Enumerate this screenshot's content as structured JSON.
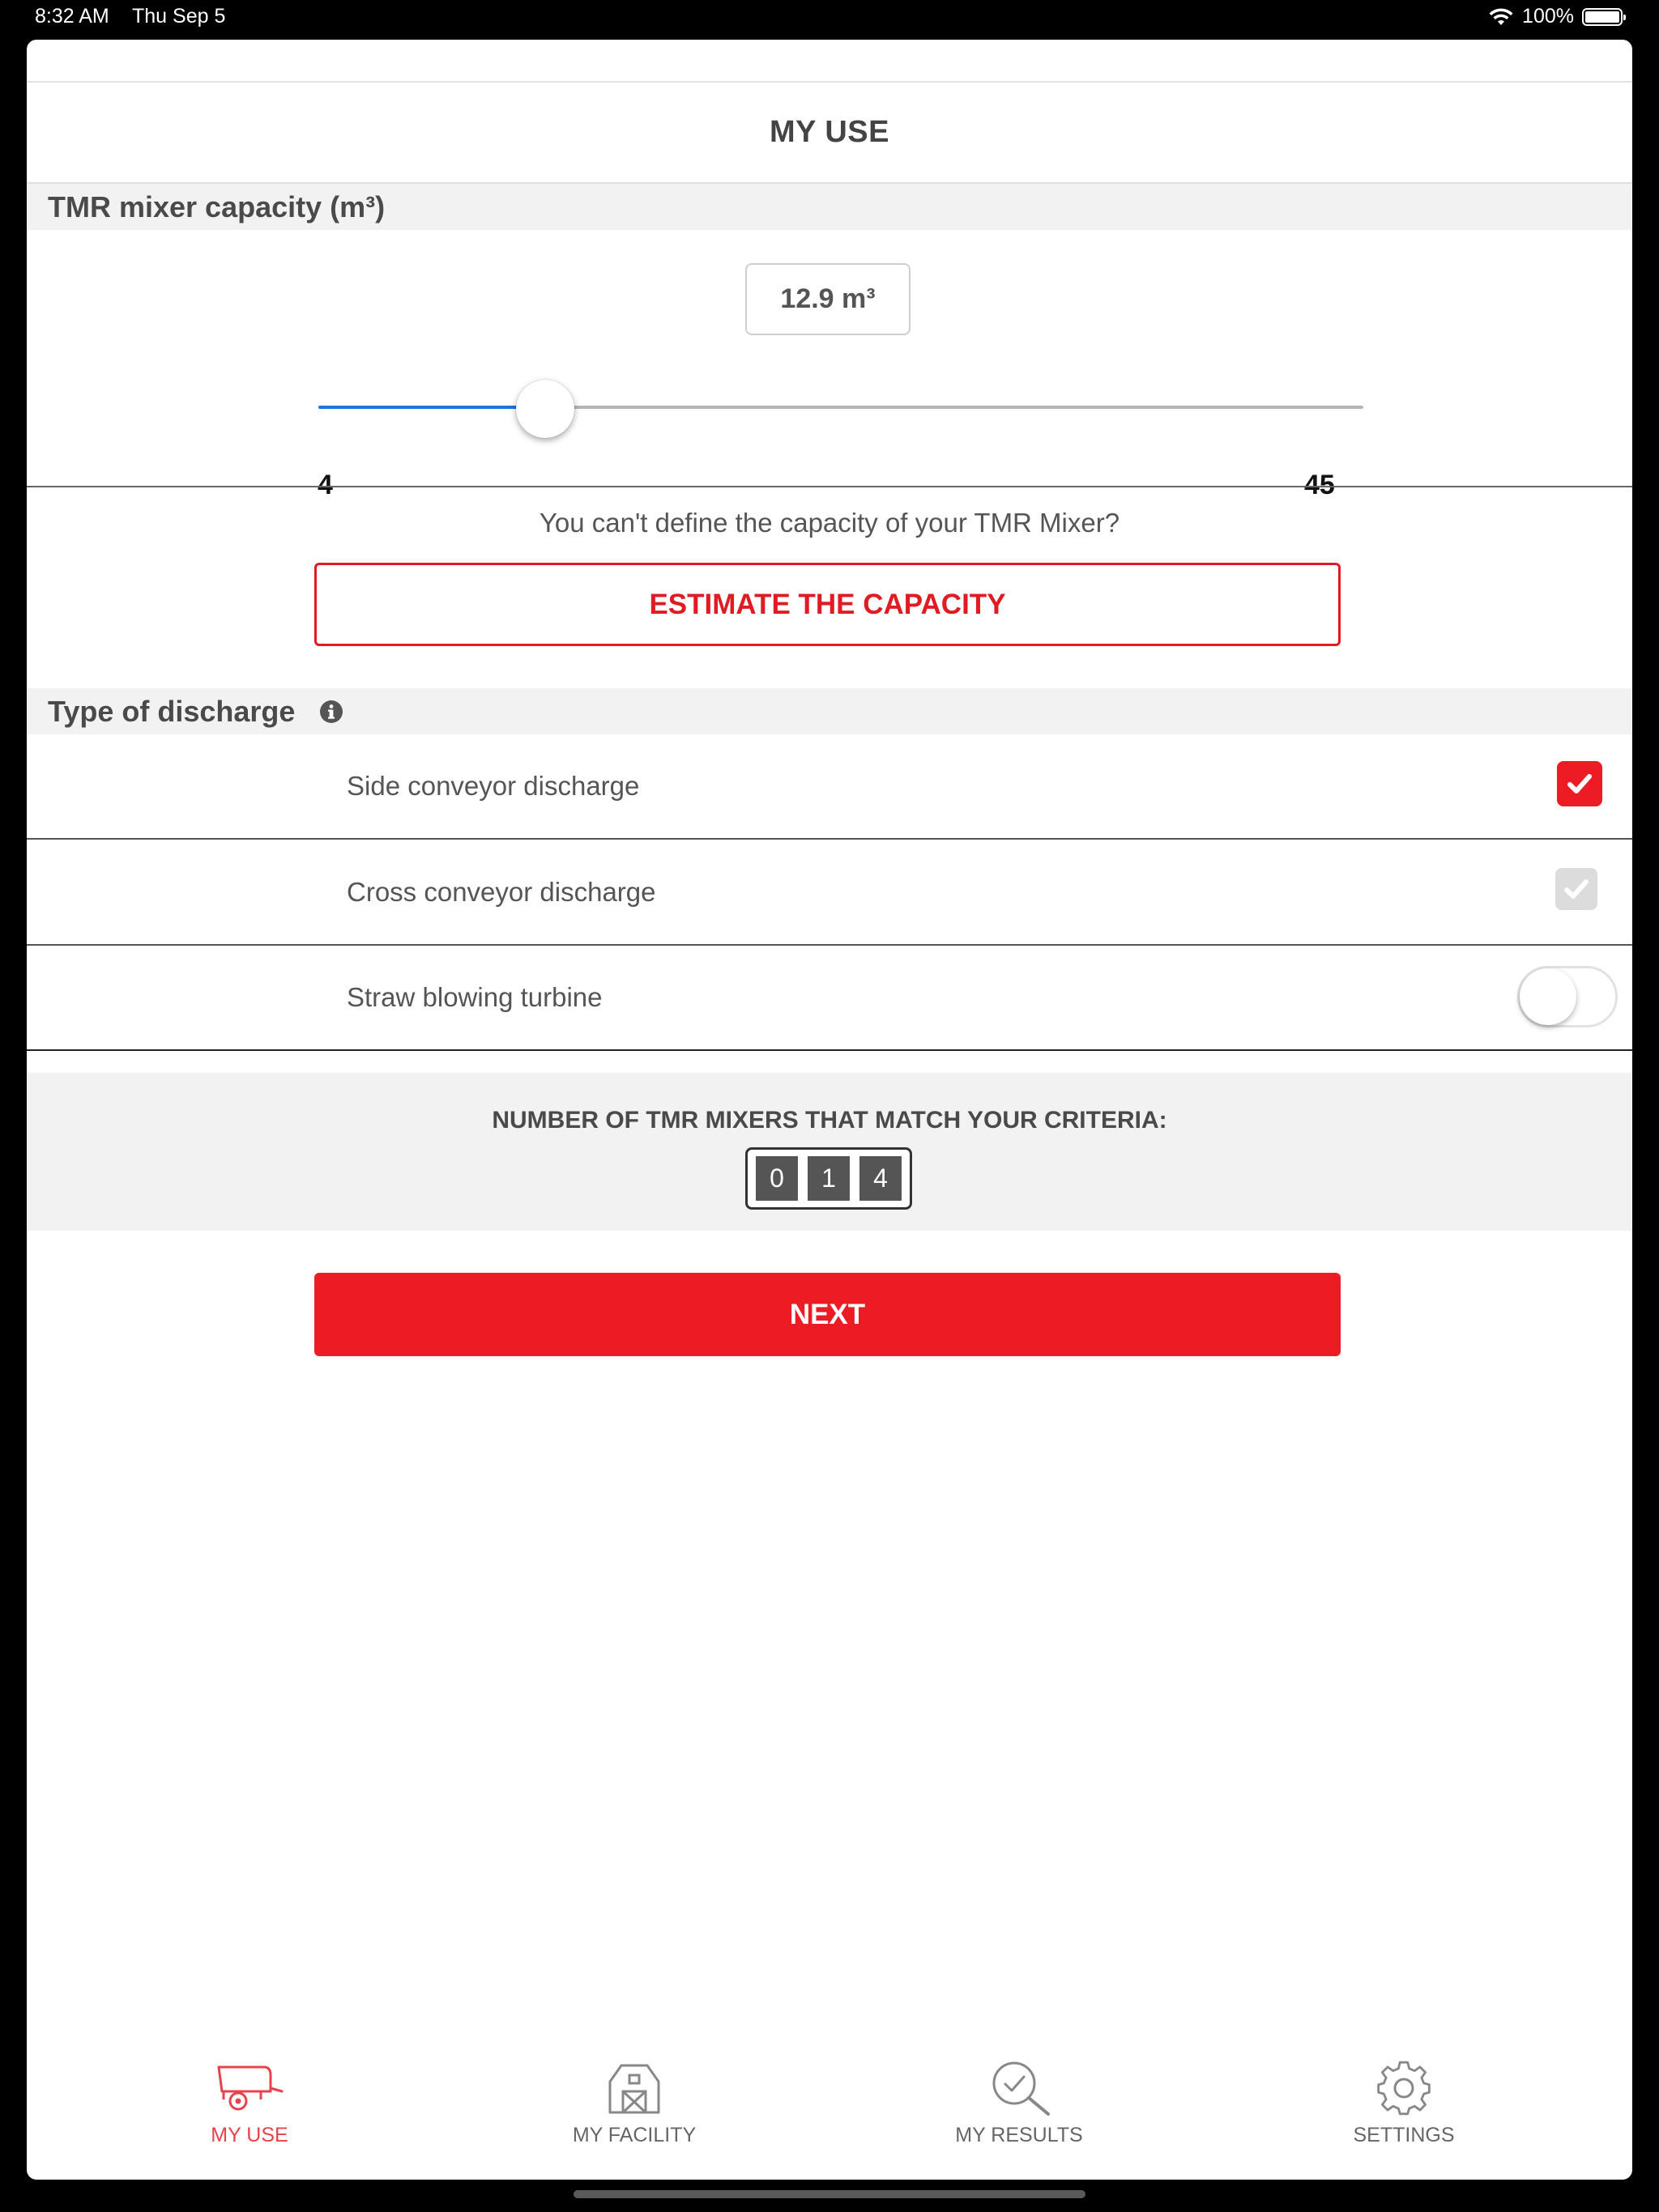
{
  "status_bar": {
    "time": "8:32 AM",
    "date": "Thu Sep 5",
    "battery": "100%"
  },
  "header": {
    "title": "MY USE"
  },
  "capacity": {
    "section_title": "TMR mixer capacity (m³)",
    "value_display": "12.9 m³",
    "value": 12.9,
    "min_label": "4",
    "max_label": "45",
    "min": 4,
    "max": 45
  },
  "estimate": {
    "question": "You can't define the capacity of your TMR Mixer?",
    "button_label": "ESTIMATE THE CAPACITY"
  },
  "discharge": {
    "section_title": "Type of discharge",
    "options": [
      {
        "label": "Side conveyor discharge",
        "state": "checked"
      },
      {
        "label": "Cross conveyor discharge",
        "state": "checked-disabled"
      },
      {
        "label": "Straw blowing turbine",
        "state": "off"
      }
    ]
  },
  "criteria": {
    "title": "NUMBER OF TMR MIXERS THAT MATCH YOUR CRITERIA:",
    "digits": [
      "0",
      "1",
      "4"
    ]
  },
  "next_label": "NEXT",
  "tabs": [
    {
      "label": "MY USE",
      "icon": "mixer-wagon-icon",
      "active": true
    },
    {
      "label": "MY FACILITY",
      "icon": "barn-icon",
      "active": false
    },
    {
      "label": "MY RESULTS",
      "icon": "magnifier-check-icon",
      "active": false
    },
    {
      "label": "SETTINGS",
      "icon": "gear-icon",
      "active": false
    }
  ],
  "colors": {
    "accent_red": "#ec1c24",
    "slider_blue": "#1f72e0",
    "active_tab": "#e8424a"
  }
}
